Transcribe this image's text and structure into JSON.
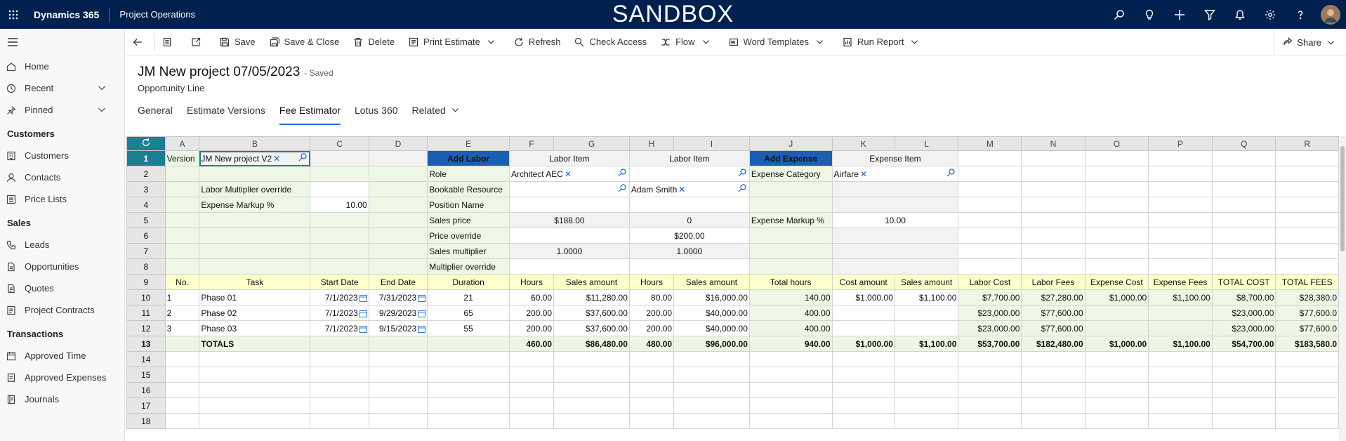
{
  "topbar": {
    "brand": "Dynamics 365",
    "app": "Project Operations",
    "banner": "SANDBOX"
  },
  "sidebar": {
    "items_top": [
      {
        "label": "Home",
        "icon": "home-icon"
      },
      {
        "label": "Recent",
        "icon": "clock-icon",
        "chevron": true
      },
      {
        "label": "Pinned",
        "icon": "pin-icon",
        "chevron": true
      }
    ],
    "groups": [
      {
        "title": "Customers",
        "items": [
          "Customers",
          "Contacts",
          "Price Lists"
        ]
      },
      {
        "title": "Sales",
        "items": [
          "Leads",
          "Opportunities",
          "Quotes",
          "Project Contracts"
        ]
      },
      {
        "title": "Transactions",
        "items": [
          "Approved Time",
          "Approved Expenses",
          "Journals"
        ]
      }
    ]
  },
  "cmd": {
    "save": "Save",
    "save_close": "Save & Close",
    "delete": "Delete",
    "print": "Print Estimate",
    "refresh": "Refresh",
    "check_access": "Check Access",
    "flow": "Flow",
    "word": "Word Templates",
    "report": "Run Report",
    "share": "Share"
  },
  "record": {
    "title": "JM New project 07/05/2023",
    "status": "- Saved",
    "entity": "Opportunity Line"
  },
  "tabs": [
    "General",
    "Estimate Versions",
    "Fee Estimator",
    "Lotus 360",
    "Related"
  ],
  "sheet": {
    "columns": [
      "A",
      "B",
      "C",
      "D",
      "E",
      "F",
      "G",
      "H",
      "I",
      "J",
      "K",
      "L",
      "M",
      "N",
      "O",
      "P",
      "Q",
      "R"
    ],
    "r1": {
      "A": "Version",
      "B": "JM New project V2",
      "E": "Add Labor",
      "FG": "Labor Item",
      "HI": "Labor Item",
      "J": "Add Expense",
      "KL": "Expense Item"
    },
    "r2": {
      "E": "Role",
      "FG": "Architect AEC",
      "J": "Expense Category",
      "KL": "Airfare"
    },
    "r3": {
      "B": "Labor Multiplier override",
      "E": "Bookable Resource",
      "HI": "Adam Smith"
    },
    "r4": {
      "B": "Expense Markup %",
      "C": "10.00",
      "E": "Position Name"
    },
    "r5": {
      "E": "Sales price",
      "FG": "$188.00",
      "HI": "0",
      "J": "Expense Markup %",
      "KL": "10.00"
    },
    "r6": {
      "E": "Price override",
      "HI": "$200.00"
    },
    "r7": {
      "E": "Sales multiplier",
      "FG": "1.0000",
      "HI": "1.0000"
    },
    "r8": {
      "E": "Multiplier override"
    },
    "headers": [
      "No.",
      "Task",
      "Start Date",
      "End Date",
      "Duration",
      "Hours",
      "Sales amount",
      "Hours",
      "Sales amount",
      "Total hours",
      "Cost amount",
      "Sales amount",
      "Labor Cost",
      "Labor Fees",
      "Expense Cost",
      "Expense Fees",
      "TOTAL COST",
      "TOTAL FEES"
    ],
    "rows": [
      [
        "1",
        "Phase 01",
        "7/1/2023",
        "7/31/2023",
        "21",
        "60.00",
        "$11,280.00",
        "80.00",
        "$16,000.00",
        "140.00",
        "$1,000.00",
        "$1,100.00",
        "$7,700.00",
        "$27,280.00",
        "$1,000.00",
        "$1,100.00",
        "$8,700.00",
        "$28,380.0"
      ],
      [
        "2",
        "Phase 02",
        "7/1/2023",
        "9/29/2023",
        "65",
        "200.00",
        "$37,600.00",
        "200.00",
        "$40,000.00",
        "400.00",
        "",
        "",
        "$23,000.00",
        "$77,600.00",
        "",
        "",
        "$23,000.00",
        "$77,600.0"
      ],
      [
        "3",
        "Phase 03",
        "7/1/2023",
        "9/15/2023",
        "55",
        "200.00",
        "$37,600.00",
        "200.00",
        "$40,000.00",
        "400.00",
        "",
        "",
        "$23,000.00",
        "$77,600.00",
        "",
        "",
        "$23,000.00",
        "$77,600.0"
      ]
    ],
    "totals": [
      "",
      "TOTALS",
      "",
      "",
      "",
      "460.00",
      "$86,480.00",
      "480.00",
      "$96,000.00",
      "940.00",
      "$1,000.00",
      "$1,100.00",
      "$53,700.00",
      "$182,480.00",
      "$1,000.00",
      "$1,100.00",
      "$54,700.00",
      "$183,580.0"
    ],
    "row_numbers": [
      "1",
      "2",
      "3",
      "4",
      "5",
      "6",
      "7",
      "8",
      "9",
      "10",
      "11",
      "12",
      "13",
      "14",
      "15",
      "16",
      "17",
      "18"
    ]
  }
}
